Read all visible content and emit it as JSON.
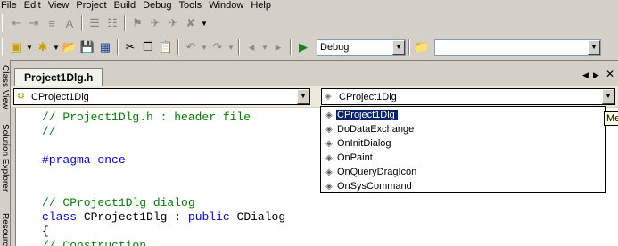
{
  "menu": [
    "File",
    "Edit",
    "View",
    "Project",
    "Build",
    "Debug",
    "Tools",
    "Window",
    "Help"
  ],
  "toolbar": {
    "configuration": "Debug"
  },
  "side_tabs": [
    "Class View",
    "Solution Explorer",
    "Resource"
  ],
  "document_tab": "Project1Dlg.h",
  "nav": {
    "class_combo": "CProject1Dlg",
    "member_combo": "CProject1Dlg"
  },
  "code_lines": [
    {
      "text": "// Project1Dlg.h : header file",
      "kind": "comment"
    },
    {
      "text": "//",
      "kind": "comment"
    },
    {
      "text": "",
      "kind": "plain"
    },
    {
      "text": "#pragma once",
      "kind": "keyword"
    },
    {
      "text": "",
      "kind": "plain"
    },
    {
      "text": "",
      "kind": "plain"
    },
    {
      "text": "// CProject1Dlg dialog",
      "kind": "comment"
    },
    {
      "text": "class CProject1Dlg : public CDialog",
      "kind": "classdecl"
    },
    {
      "text": "{",
      "kind": "plain"
    },
    {
      "text": "// Construction",
      "kind": "comment"
    }
  ],
  "members": [
    "CProject1Dlg",
    "DoDataExchange",
    "OnInitDialog",
    "OnPaint",
    "OnQueryDragIcon",
    "OnSysCommand"
  ],
  "selected_member_index": 0,
  "tooltip_text": "Me",
  "colors": {
    "selection": "#0a246a",
    "comment": "#008000",
    "keyword": "#0000ff"
  }
}
